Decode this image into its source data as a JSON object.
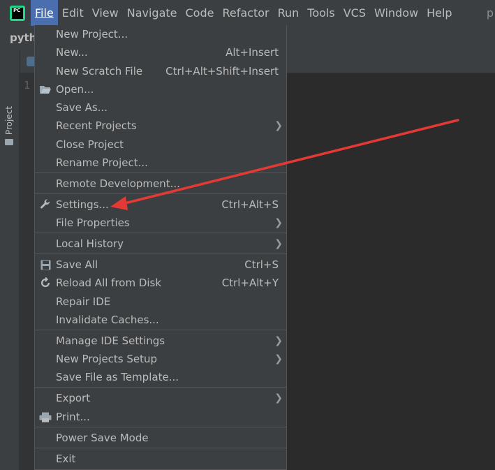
{
  "menubar": {
    "items": [
      "File",
      "Edit",
      "View",
      "Navigate",
      "Code",
      "Refactor",
      "Run",
      "Tools",
      "VCS",
      "Window",
      "Help"
    ],
    "active": "File",
    "right_text": "p",
    "logo_text": "PC"
  },
  "navbar": {
    "crumb": "pyth"
  },
  "left_stripe": {
    "project_label": "Project"
  },
  "editor": {
    "line_number": "1"
  },
  "file_menu": {
    "new_project": "New Project...",
    "new": "New...",
    "new_shortcut": "Alt+Insert",
    "new_scratch": "New Scratch File",
    "new_scratch_shortcut": "Ctrl+Alt+Shift+Insert",
    "open": "Open...",
    "save_as": "Save As...",
    "recent_projects": "Recent Projects",
    "close_project": "Close Project",
    "rename_project": "Rename Project...",
    "remote_development": "Remote Development...",
    "settings": "Settings...",
    "settings_shortcut": "Ctrl+Alt+S",
    "file_properties": "File Properties",
    "local_history": "Local History",
    "save_all": "Save All",
    "save_all_shortcut": "Ctrl+S",
    "reload_all": "Reload All from Disk",
    "reload_all_shortcut": "Ctrl+Alt+Y",
    "repair_ide": "Repair IDE",
    "invalidate_caches": "Invalidate Caches...",
    "manage_ide_settings": "Manage IDE Settings",
    "new_projects_setup": "New Projects Setup",
    "save_file_as_template": "Save File as Template...",
    "export": "Export",
    "print": "Print...",
    "power_save_mode": "Power Save Mode",
    "exit": "Exit"
  },
  "colors": {
    "menubar_bg": "#3c3f41",
    "active_menu": "#4b6eaf",
    "editor_bg": "#2b2b2b",
    "annotation_arrow": "#e53935"
  },
  "icons": [
    "folder-icon",
    "wrench-icon",
    "save-icon",
    "reload-icon",
    "printer-icon",
    "submenu-arrow-icon"
  ]
}
